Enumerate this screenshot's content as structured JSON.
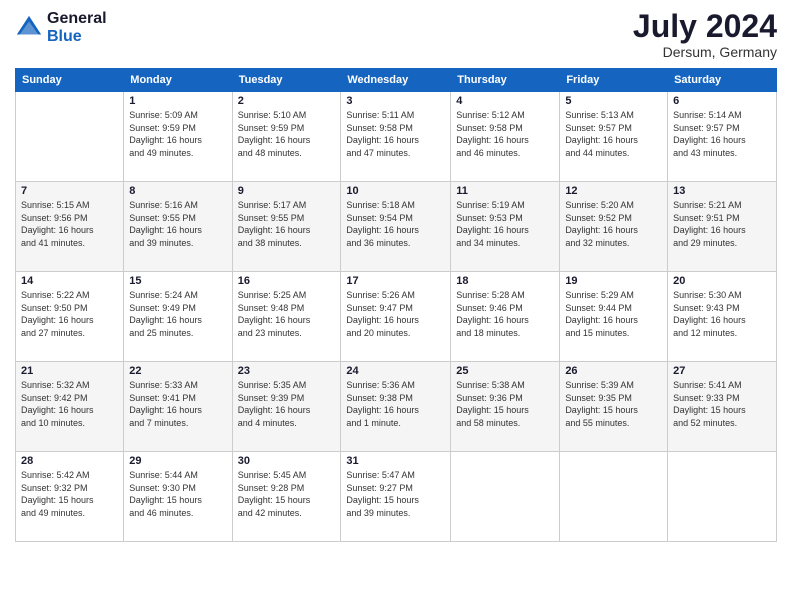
{
  "logo": {
    "line1": "General",
    "line2": "Blue"
  },
  "title": "July 2024",
  "location": "Dersum, Germany",
  "days_header": [
    "Sunday",
    "Monday",
    "Tuesday",
    "Wednesday",
    "Thursday",
    "Friday",
    "Saturday"
  ],
  "weeks": [
    [
      {
        "num": "",
        "info": ""
      },
      {
        "num": "1",
        "info": "Sunrise: 5:09 AM\nSunset: 9:59 PM\nDaylight: 16 hours\nand 49 minutes."
      },
      {
        "num": "2",
        "info": "Sunrise: 5:10 AM\nSunset: 9:59 PM\nDaylight: 16 hours\nand 48 minutes."
      },
      {
        "num": "3",
        "info": "Sunrise: 5:11 AM\nSunset: 9:58 PM\nDaylight: 16 hours\nand 47 minutes."
      },
      {
        "num": "4",
        "info": "Sunrise: 5:12 AM\nSunset: 9:58 PM\nDaylight: 16 hours\nand 46 minutes."
      },
      {
        "num": "5",
        "info": "Sunrise: 5:13 AM\nSunset: 9:57 PM\nDaylight: 16 hours\nand 44 minutes."
      },
      {
        "num": "6",
        "info": "Sunrise: 5:14 AM\nSunset: 9:57 PM\nDaylight: 16 hours\nand 43 minutes."
      }
    ],
    [
      {
        "num": "7",
        "info": "Sunrise: 5:15 AM\nSunset: 9:56 PM\nDaylight: 16 hours\nand 41 minutes."
      },
      {
        "num": "8",
        "info": "Sunrise: 5:16 AM\nSunset: 9:55 PM\nDaylight: 16 hours\nand 39 minutes."
      },
      {
        "num": "9",
        "info": "Sunrise: 5:17 AM\nSunset: 9:55 PM\nDaylight: 16 hours\nand 38 minutes."
      },
      {
        "num": "10",
        "info": "Sunrise: 5:18 AM\nSunset: 9:54 PM\nDaylight: 16 hours\nand 36 minutes."
      },
      {
        "num": "11",
        "info": "Sunrise: 5:19 AM\nSunset: 9:53 PM\nDaylight: 16 hours\nand 34 minutes."
      },
      {
        "num": "12",
        "info": "Sunrise: 5:20 AM\nSunset: 9:52 PM\nDaylight: 16 hours\nand 32 minutes."
      },
      {
        "num": "13",
        "info": "Sunrise: 5:21 AM\nSunset: 9:51 PM\nDaylight: 16 hours\nand 29 minutes."
      }
    ],
    [
      {
        "num": "14",
        "info": "Sunrise: 5:22 AM\nSunset: 9:50 PM\nDaylight: 16 hours\nand 27 minutes."
      },
      {
        "num": "15",
        "info": "Sunrise: 5:24 AM\nSunset: 9:49 PM\nDaylight: 16 hours\nand 25 minutes."
      },
      {
        "num": "16",
        "info": "Sunrise: 5:25 AM\nSunset: 9:48 PM\nDaylight: 16 hours\nand 23 minutes."
      },
      {
        "num": "17",
        "info": "Sunrise: 5:26 AM\nSunset: 9:47 PM\nDaylight: 16 hours\nand 20 minutes."
      },
      {
        "num": "18",
        "info": "Sunrise: 5:28 AM\nSunset: 9:46 PM\nDaylight: 16 hours\nand 18 minutes."
      },
      {
        "num": "19",
        "info": "Sunrise: 5:29 AM\nSunset: 9:44 PM\nDaylight: 16 hours\nand 15 minutes."
      },
      {
        "num": "20",
        "info": "Sunrise: 5:30 AM\nSunset: 9:43 PM\nDaylight: 16 hours\nand 12 minutes."
      }
    ],
    [
      {
        "num": "21",
        "info": "Sunrise: 5:32 AM\nSunset: 9:42 PM\nDaylight: 16 hours\nand 10 minutes."
      },
      {
        "num": "22",
        "info": "Sunrise: 5:33 AM\nSunset: 9:41 PM\nDaylight: 16 hours\nand 7 minutes."
      },
      {
        "num": "23",
        "info": "Sunrise: 5:35 AM\nSunset: 9:39 PM\nDaylight: 16 hours\nand 4 minutes."
      },
      {
        "num": "24",
        "info": "Sunrise: 5:36 AM\nSunset: 9:38 PM\nDaylight: 16 hours\nand 1 minute."
      },
      {
        "num": "25",
        "info": "Sunrise: 5:38 AM\nSunset: 9:36 PM\nDaylight: 15 hours\nand 58 minutes."
      },
      {
        "num": "26",
        "info": "Sunrise: 5:39 AM\nSunset: 9:35 PM\nDaylight: 15 hours\nand 55 minutes."
      },
      {
        "num": "27",
        "info": "Sunrise: 5:41 AM\nSunset: 9:33 PM\nDaylight: 15 hours\nand 52 minutes."
      }
    ],
    [
      {
        "num": "28",
        "info": "Sunrise: 5:42 AM\nSunset: 9:32 PM\nDaylight: 15 hours\nand 49 minutes."
      },
      {
        "num": "29",
        "info": "Sunrise: 5:44 AM\nSunset: 9:30 PM\nDaylight: 15 hours\nand 46 minutes."
      },
      {
        "num": "30",
        "info": "Sunrise: 5:45 AM\nSunset: 9:28 PM\nDaylight: 15 hours\nand 42 minutes."
      },
      {
        "num": "31",
        "info": "Sunrise: 5:47 AM\nSunset: 9:27 PM\nDaylight: 15 hours\nand 39 minutes."
      },
      {
        "num": "",
        "info": ""
      },
      {
        "num": "",
        "info": ""
      },
      {
        "num": "",
        "info": ""
      }
    ]
  ]
}
